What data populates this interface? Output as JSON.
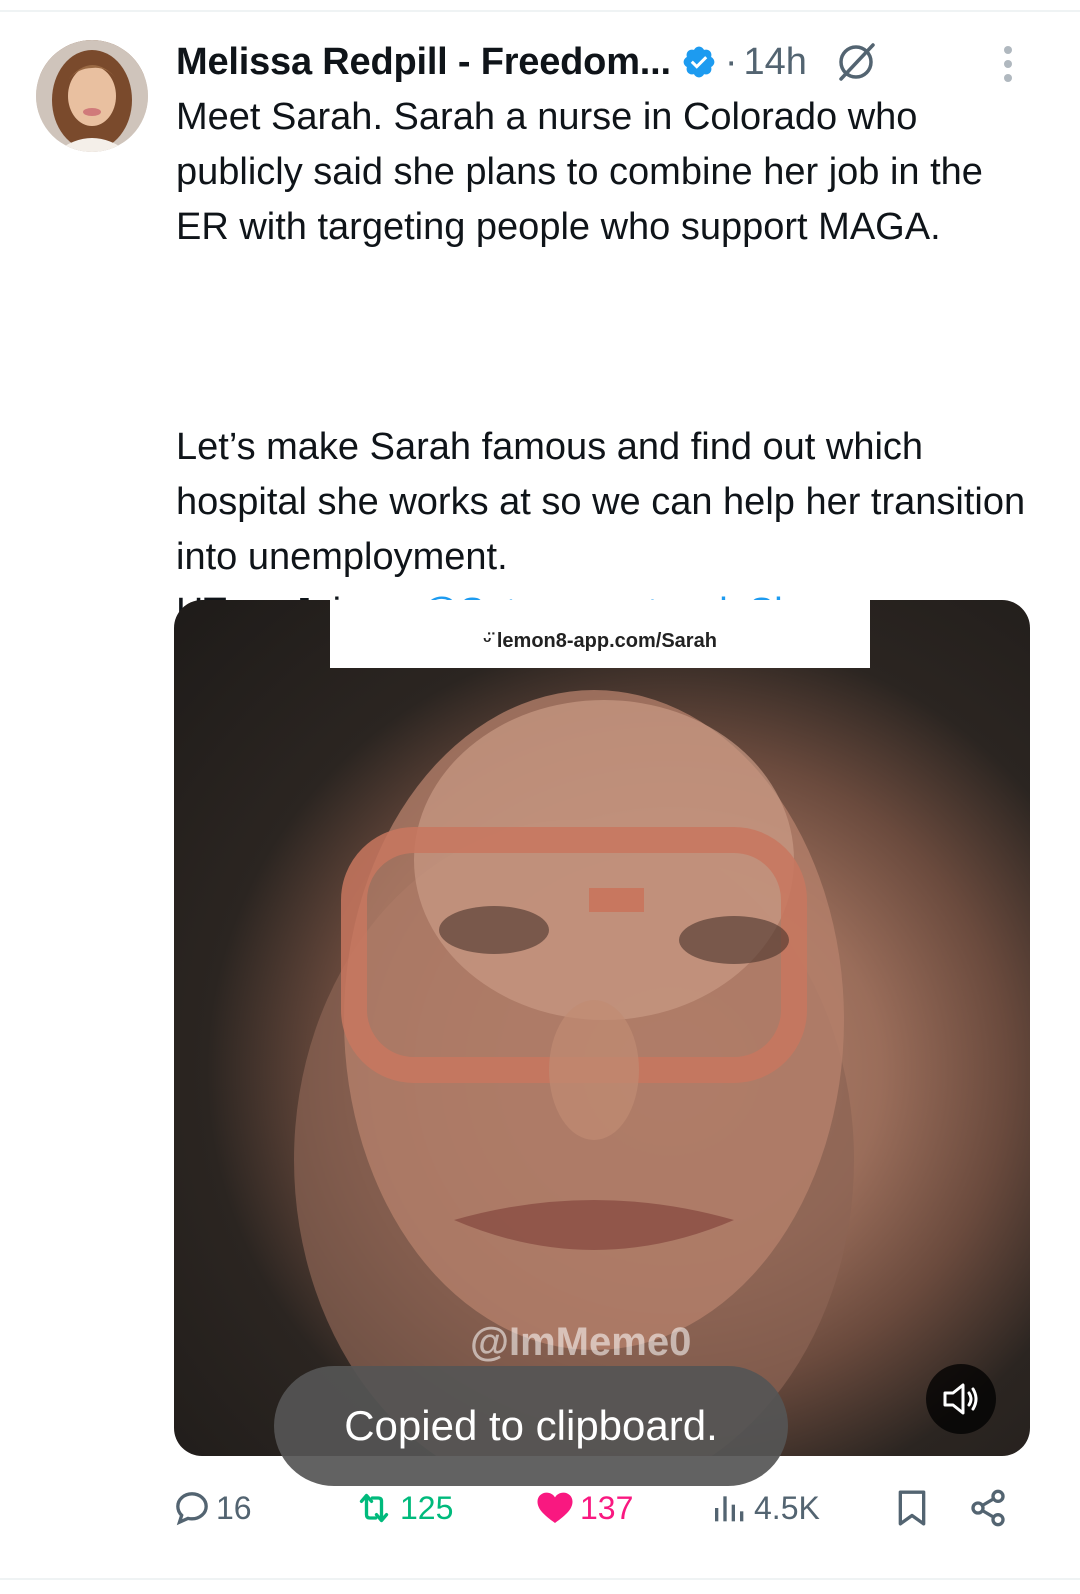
{
  "tweet": {
    "author": {
      "display_name": "Melissa Redpill - Freedom...",
      "verified": true,
      "separator": "·",
      "timestamp": "14h"
    },
    "text": {
      "paragraph1": "Meet Sarah. Sarah a nurse in Colorado who publicly said she plans to combine her job in the ER with targeting people who support MAGA.",
      "paragraph2": "Let’s make Sarah famous and find out which hospital she works at so we can help her transition into unemployment.",
      "line3_prefix": "HT ",
      "line3_join": "Join",
      "mention": "@Sgtnewsnetwork",
      "show_more": "Show more"
    },
    "media": {
      "url_text": "lemon8-app.com/Sarah",
      "watermark": "@ImMeme0"
    },
    "toast": "Copied to clipboard.",
    "metrics": {
      "replies": "16",
      "retweets": "125",
      "likes": "137",
      "views": "4.5K"
    }
  },
  "icons": {
    "verified": "verified-badge-icon",
    "grok": "grok-icon",
    "more": "more-options-icon",
    "volume": "volume-icon",
    "reply": "reply-icon",
    "retweet": "retweet-icon",
    "like": "heart-icon",
    "views": "views-icon",
    "bookmark": "bookmark-icon",
    "share": "share-icon"
  },
  "colors": {
    "link": "#1d9bf0",
    "retweet": "#00ba7c",
    "like": "#f91880",
    "muted": "#536471"
  }
}
